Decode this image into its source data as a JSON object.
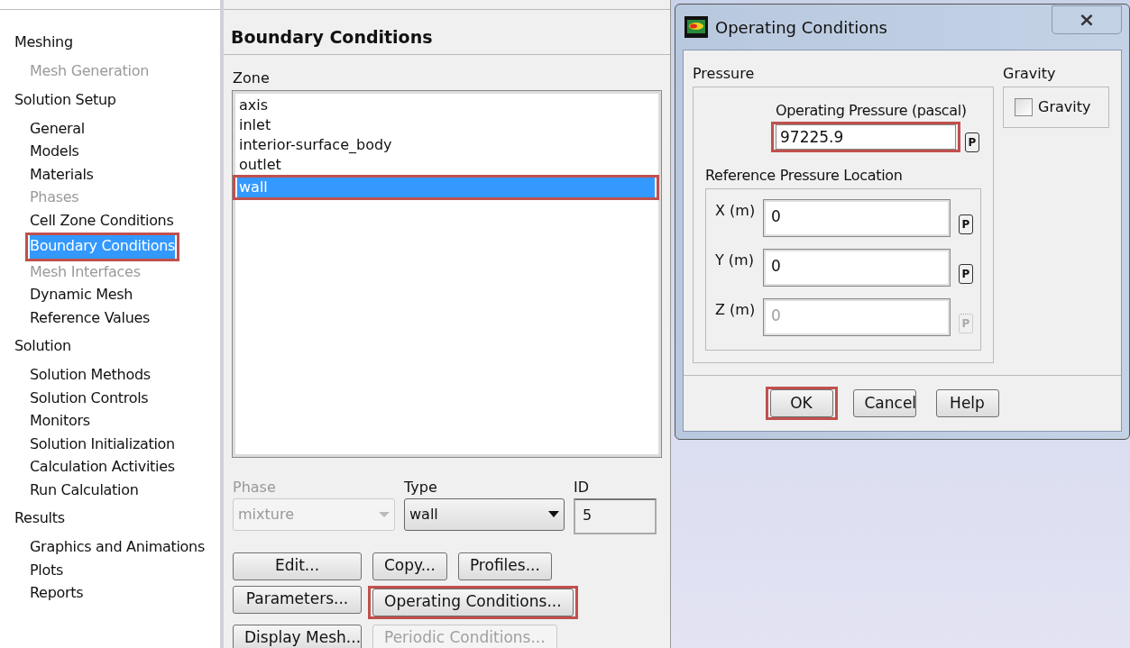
{
  "nav": [
    {
      "label": "Meshing",
      "children": [
        {
          "label": "Mesh Generation",
          "disabled": true,
          "selected": false,
          "highlighted": false
        }
      ]
    },
    {
      "label": "Solution Setup",
      "children": [
        {
          "label": "General",
          "disabled": false,
          "selected": false,
          "highlighted": false
        },
        {
          "label": "Models",
          "disabled": false,
          "selected": false,
          "highlighted": false
        },
        {
          "label": "Materials",
          "disabled": false,
          "selected": false,
          "highlighted": false
        },
        {
          "label": "Phases",
          "disabled": true,
          "selected": false,
          "highlighted": false
        },
        {
          "label": "Cell Zone Conditions",
          "disabled": false,
          "selected": false,
          "highlighted": false
        },
        {
          "label": "Boundary Conditions",
          "disabled": false,
          "selected": true,
          "highlighted": true
        },
        {
          "label": "Mesh Interfaces",
          "disabled": true,
          "selected": false,
          "highlighted": false
        },
        {
          "label": "Dynamic Mesh",
          "disabled": false,
          "selected": false,
          "highlighted": false
        },
        {
          "label": "Reference Values",
          "disabled": false,
          "selected": false,
          "highlighted": false
        }
      ]
    },
    {
      "label": "Solution",
      "children": [
        {
          "label": "Solution Methods",
          "disabled": false,
          "selected": false,
          "highlighted": false
        },
        {
          "label": "Solution Controls",
          "disabled": false,
          "selected": false,
          "highlighted": false
        },
        {
          "label": "Monitors",
          "disabled": false,
          "selected": false,
          "highlighted": false
        },
        {
          "label": "Solution Initialization",
          "disabled": false,
          "selected": false,
          "highlighted": false
        },
        {
          "label": "Calculation Activities",
          "disabled": false,
          "selected": false,
          "highlighted": false
        },
        {
          "label": "Run Calculation",
          "disabled": false,
          "selected": false,
          "highlighted": false
        }
      ]
    },
    {
      "label": "Results",
      "children": [
        {
          "label": "Graphics and Animations",
          "disabled": false,
          "selected": false,
          "highlighted": false
        },
        {
          "label": "Plots",
          "disabled": false,
          "selected": false,
          "highlighted": false
        },
        {
          "label": "Reports",
          "disabled": false,
          "selected": false,
          "highlighted": false
        }
      ]
    }
  ],
  "boundary_panel": {
    "title": "Boundary Conditions",
    "zone_label": "Zone",
    "zones": [
      {
        "label": "axis",
        "selected": false,
        "highlighted": false
      },
      {
        "label": "inlet",
        "selected": false,
        "highlighted": false
      },
      {
        "label": "interior-surface_body",
        "selected": false,
        "highlighted": false
      },
      {
        "label": "outlet",
        "selected": false,
        "highlighted": false
      },
      {
        "label": "wall",
        "selected": true,
        "highlighted": true
      }
    ],
    "phase": {
      "label": "Phase",
      "value": "mixture",
      "disabled": true
    },
    "type": {
      "label": "Type",
      "value": "wall",
      "disabled": false
    },
    "id": {
      "label": "ID",
      "value": "5"
    },
    "button_rows": [
      [
        {
          "label": "Edit...",
          "disabled": false,
          "highlighted": false
        },
        {
          "label": "Copy...",
          "disabled": false,
          "highlighted": false
        },
        {
          "label": "Profiles...",
          "disabled": false,
          "highlighted": false
        }
      ],
      [
        {
          "label": "Parameters...",
          "disabled": false,
          "highlighted": false
        },
        {
          "label": "Operating Conditions...",
          "disabled": false,
          "highlighted": true
        }
      ],
      [
        {
          "label": "Display Mesh...",
          "disabled": false,
          "highlighted": false
        },
        {
          "label": "Periodic Conditions...",
          "disabled": true,
          "highlighted": false
        }
      ]
    ]
  },
  "dialog": {
    "title": "Operating Conditions",
    "close": "×",
    "pressure_label": "Pressure",
    "operating_pressure": {
      "label": "Operating Pressure (pascal)",
      "value": "97225.9",
      "param": "P",
      "highlighted": true
    },
    "reference_label": "Reference Pressure Location",
    "coords": [
      {
        "label": "X (m)",
        "value": "0",
        "param": "P",
        "disabled": false
      },
      {
        "label": "Y (m)",
        "value": "0",
        "param": "P",
        "disabled": false
      },
      {
        "label": "Z (m)",
        "value": "0",
        "param": "P",
        "disabled": true
      }
    ],
    "gravity_label": "Gravity",
    "gravity": {
      "label": "Gravity",
      "checked": false
    },
    "buttons": [
      {
        "label": "OK",
        "highlighted": true
      },
      {
        "label": "Cancel",
        "highlighted": false
      },
      {
        "label": "Help",
        "highlighted": false
      }
    ]
  }
}
